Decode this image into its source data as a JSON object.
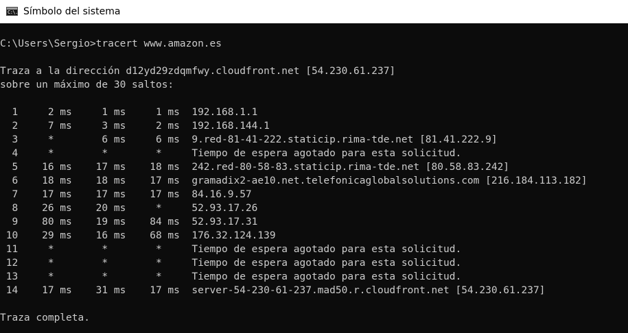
{
  "window": {
    "title": "Símbolo del sistema",
    "icon": "cmd-icon",
    "icon_glyph": "C:\\."
  },
  "console": {
    "text_color": "#cccccc",
    "background": "#0c0c0c",
    "lines": [
      "C:\\Users\\Sergio>tracert www.amazon.es",
      "Traza a la dirección d12yd29zdqmfwy.cloudfront.net [54.230.61.237]",
      "sobre un máximo de 30 saltos:",
      "  1     2 ms     1 ms     1 ms  192.168.1.1",
      "  2     7 ms     3 ms     2 ms  192.168.144.1",
      "  3     *        6 ms     6 ms  9.red-81-41-222.staticip.rima-tde.net [81.41.222.9]",
      "  4     *        *        *     Tiempo de espera agotado para esta solicitud.",
      "  5    16 ms    17 ms    18 ms  242.red-80-58-83.staticip.rima-tde.net [80.58.83.242]",
      "  6    18 ms    18 ms    17 ms  gramadix2-ae10.net.telefonicaglobalsolutions.com [216.184.113.182]",
      "  7    17 ms    17 ms    17 ms  84.16.9.57",
      "  8    26 ms    20 ms     *     52.93.17.26",
      "  9    80 ms    19 ms    84 ms  52.93.17.31",
      " 10    29 ms    16 ms    68 ms  176.32.124.139",
      " 11     *        *        *     Tiempo de espera agotado para esta solicitud.",
      " 12     *        *        *     Tiempo de espera agotado para esta solicitud.",
      " 13     *        *        *     Tiempo de espera agotado para esta solicitud.",
      " 14    17 ms    31 ms    17 ms  server-54-230-61-237.mad50.r.cloudfront.net [54.230.61.237]",
      "Traza completa."
    ]
  }
}
